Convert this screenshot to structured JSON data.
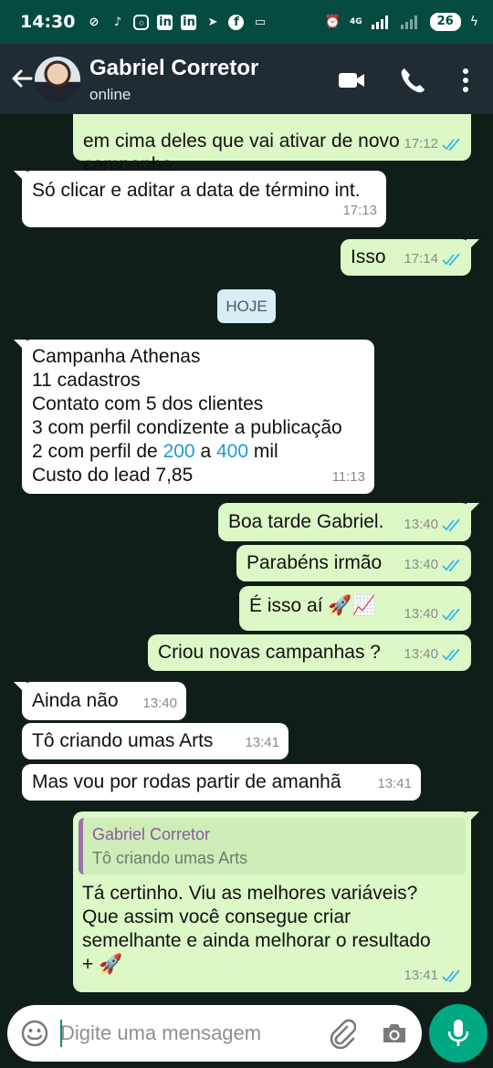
{
  "status_bar": {
    "time": "14:30",
    "network": "4G",
    "battery": "26"
  },
  "header": {
    "contact_name": "Gabriel Corretor",
    "status": "online"
  },
  "messages": [
    {
      "dir": "out",
      "text": "em cima deles que vai ativar de novo\ncampanha.",
      "time": "17:12"
    },
    {
      "dir": "in",
      "text": "Só clicar e aditar a data de término int.",
      "time": "17:13"
    },
    {
      "dir": "out",
      "text": "Isso",
      "time": "17:14"
    },
    {
      "dir": "in",
      "lines": [
        "Campanha Athenas",
        "11 cadastros",
        "Contato com 5 dos clientes",
        "3 com perfil condizente a publicação"
      ],
      "line5_pre": "2 com perfil de ",
      "line5_num1": "200",
      "line5_mid": " a ",
      "line5_num2": "400",
      "line5_post": " mil",
      "line6": "Custo do lead 7,85",
      "time": "11:13"
    },
    {
      "dir": "out",
      "text": "Boa tarde Gabriel.",
      "time": "13:40"
    },
    {
      "dir": "out",
      "text": "Parabéns irmão",
      "time": "13:40"
    },
    {
      "dir": "out",
      "text": "É isso aí 🚀📈",
      "time": "13:40"
    },
    {
      "dir": "out",
      "text": "Criou novas campanhas ?",
      "time": "13:40"
    },
    {
      "dir": "in",
      "text": "Ainda não",
      "time": "13:40"
    },
    {
      "dir": "in",
      "text": "Tô criando umas Arts",
      "time": "13:41"
    },
    {
      "dir": "in",
      "text": "Mas vou por rodas partir de amanhã",
      "time": "13:41"
    },
    {
      "dir": "out",
      "quote_name": "Gabriel Corretor",
      "quote_text": "Tô criando umas Arts",
      "text": "Tá certinho. Viu as melhores variáveis?\nQue assim você consegue criar\nsemelhante e ainda melhorar o resultado\n+ 🚀",
      "time": "13:41"
    }
  ],
  "date_divider": "HOJE",
  "composer": {
    "placeholder": "Digite uma mensagem"
  },
  "colors": {
    "header_bg": "#1f2c34",
    "status_bg": "#054b40",
    "chat_bg": "#0f1e19",
    "incoming_bubble": "#ffffff",
    "outgoing_bubble": "#dcf8c6",
    "read_ticks": "#34b7f1",
    "mic_button": "#00a884"
  },
  "icons": [
    "back-arrow-icon",
    "video-call-icon",
    "phone-call-icon",
    "more-options-icon",
    "emoji-icon",
    "attach-icon",
    "camera-icon",
    "mic-icon",
    "double-tick-icon"
  ]
}
